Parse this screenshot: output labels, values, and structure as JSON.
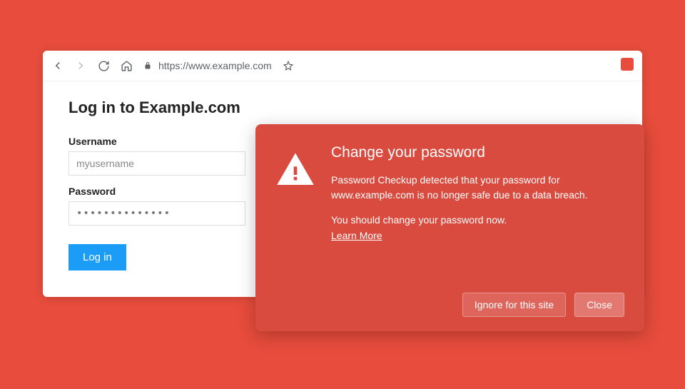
{
  "browser": {
    "url": "https://www.example.com"
  },
  "page": {
    "title": "Log in to Example.com",
    "username_label": "Username",
    "username_value": "myusername",
    "password_label": "Password",
    "password_value": "••••••••••••••",
    "login_button": "Log in"
  },
  "alert": {
    "title": "Change your password",
    "body": "Password Checkup detected that your password for www.example.com is no longer safe due to a data breach.",
    "recommend": "You should change your password now.",
    "learn_more": "Learn More",
    "ignore_button": "Ignore for this site",
    "close_button": "Close"
  }
}
